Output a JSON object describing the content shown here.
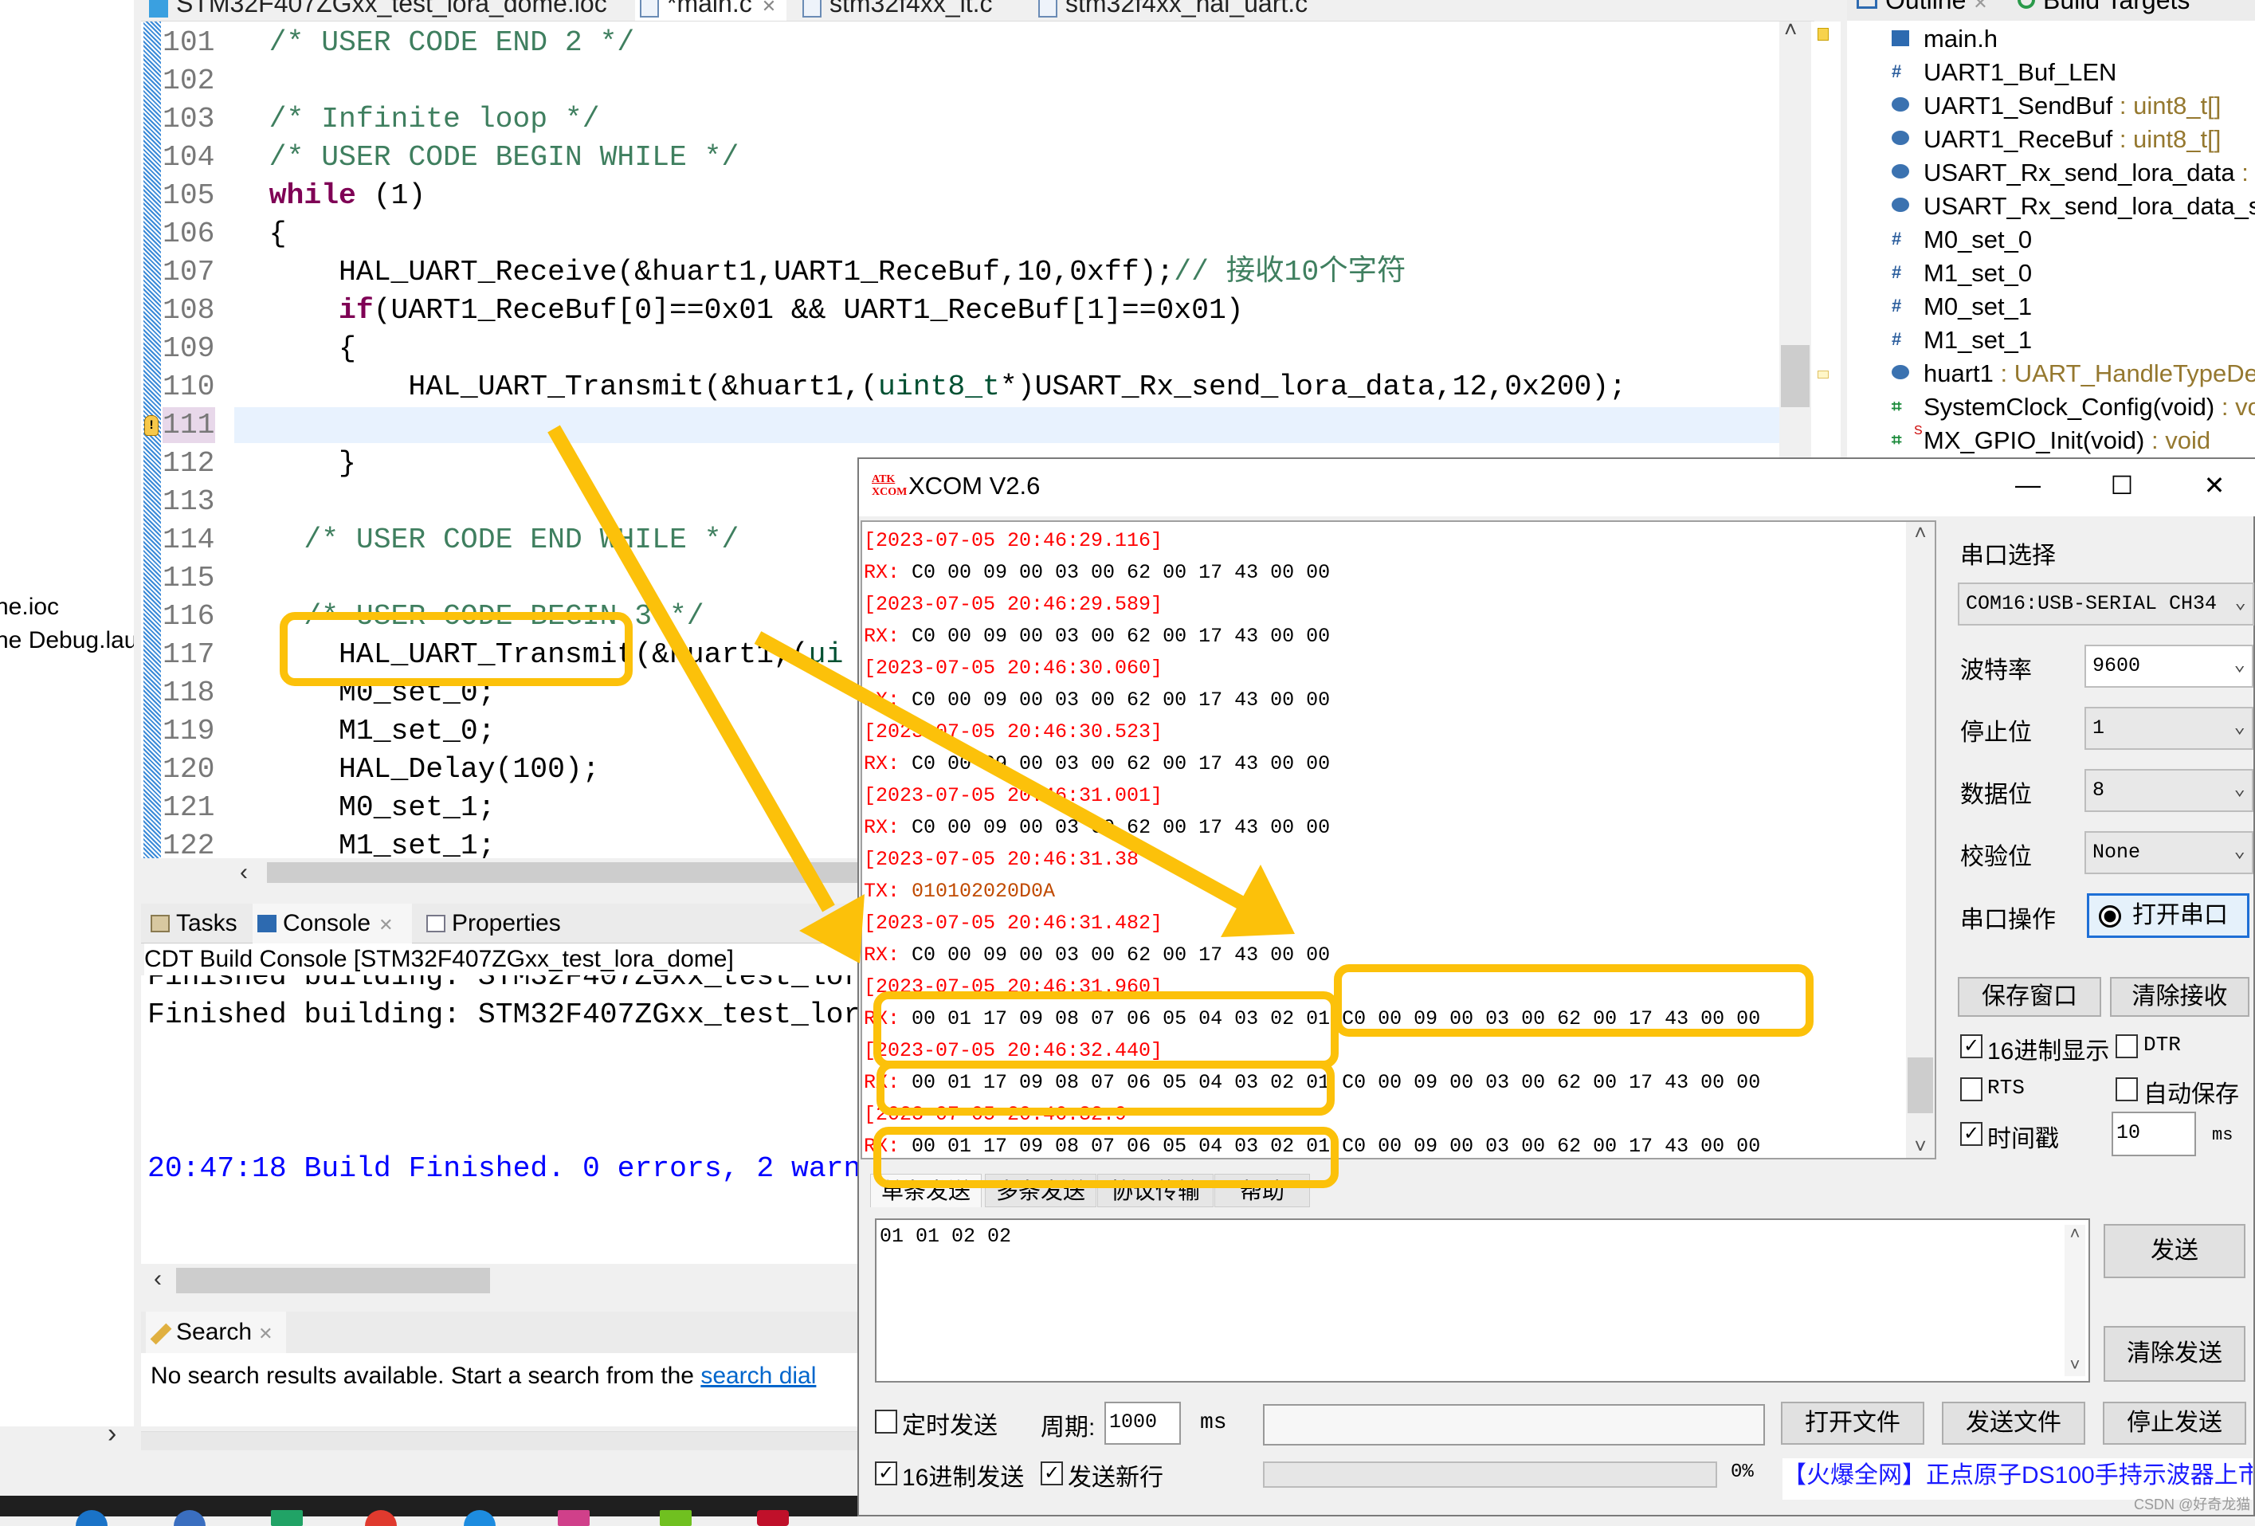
{
  "ide": {
    "left_panel": {
      "items": [
        "ne.ioc",
        "ne Debug.lau"
      ]
    },
    "editor_tabs": [
      {
        "label": "STM32F407ZGxx_test_lora_dome.ioc",
        "active": false
      },
      {
        "label": "*main.c",
        "active": true
      },
      {
        "label": "stm32f4xx_it.c",
        "active": false
      },
      {
        "label": "stm32f4xx_hal_uart.c",
        "active": false
      }
    ],
    "editor": {
      "current_line": "111",
      "warning_line": "111",
      "lines": [
        {
          "n": "101",
          "segs": [
            {
              "t": "  /* USER CODE END 2 */",
              "k": "comment"
            }
          ]
        },
        {
          "n": "102",
          "segs": []
        },
        {
          "n": "103",
          "segs": [
            {
              "t": "  /* Infinite loop */",
              "k": "comment"
            }
          ]
        },
        {
          "n": "104",
          "segs": [
            {
              "t": "  /* USER CODE BEGIN WHILE */",
              "k": "comment"
            }
          ]
        },
        {
          "n": "105",
          "segs": [
            {
              "t": "  ",
              "k": "plain"
            },
            {
              "t": "while",
              "k": "keyword"
            },
            {
              "t": " (1)",
              "k": "plain"
            }
          ]
        },
        {
          "n": "106",
          "segs": [
            {
              "t": "  {",
              "k": "plain"
            }
          ]
        },
        {
          "n": "107",
          "segs": [
            {
              "t": "      HAL_UART_Receive(&huart1,UART1_ReceBuf,10,0xff);",
              "k": "plain"
            },
            {
              "t": "// 接收10个字符",
              "k": "comment"
            }
          ]
        },
        {
          "n": "108",
          "segs": [
            {
              "t": "      ",
              "k": "plain"
            },
            {
              "t": "if",
              "k": "keyword"
            },
            {
              "t": "(UART1_ReceBuf[0]==0x01 && UART1_ReceBuf[1]==0x01)",
              "k": "plain"
            }
          ]
        },
        {
          "n": "109",
          "segs": [
            {
              "t": "      {",
              "k": "plain"
            }
          ]
        },
        {
          "n": "110",
          "segs": [
            {
              "t": "          HAL_UART_Transmit(&huart1,(",
              "k": "plain"
            },
            {
              "t": "uint8_t",
              "k": "type"
            },
            {
              "t": "*)USART_Rx_send_lora_data,12,0x200);",
              "k": "plain"
            }
          ]
        },
        {
          "n": "111",
          "segs": []
        },
        {
          "n": "112",
          "segs": [
            {
              "t": "      }",
              "k": "plain"
            }
          ]
        },
        {
          "n": "113",
          "segs": []
        },
        {
          "n": "114",
          "segs": [
            {
              "t": "    /* USER CODE END WHILE */",
              "k": "comment"
            }
          ]
        },
        {
          "n": "115",
          "segs": []
        },
        {
          "n": "116",
          "segs": [
            {
              "t": "    /* USER CODE BEGIN 3 */",
              "k": "comment"
            }
          ]
        },
        {
          "n": "117",
          "segs": [
            {
              "t": "      HAL_UART_Transmit(&huart1,(",
              "k": "plain"
            },
            {
              "t": "ui",
              "k": "type"
            }
          ]
        },
        {
          "n": "118",
          "segs": [
            {
              "t": "      M0_set_0;",
              "k": "plain"
            }
          ]
        },
        {
          "n": "119",
          "segs": [
            {
              "t": "      M1_set_0;",
              "k": "plain"
            }
          ]
        },
        {
          "n": "120",
          "segs": [
            {
              "t": "      HAL_Delay(100);",
              "k": "plain"
            }
          ]
        },
        {
          "n": "121",
          "segs": [
            {
              "t": "      M0_set_1;",
              "k": "plain"
            }
          ]
        },
        {
          "n": "122",
          "segs": [
            {
              "t": "      M1_set_1;",
              "k": "plain"
            }
          ]
        }
      ]
    },
    "outline": {
      "tabs": [
        "Outline",
        "Build Targets"
      ],
      "items": [
        {
          "icon": "header",
          "name": "main.h",
          "type": ""
        },
        {
          "icon": "macro",
          "name": "UART1_Buf_LEN",
          "type": ""
        },
        {
          "icon": "var",
          "name": "UART1_SendBuf",
          "type": " : uint8_t[]"
        },
        {
          "icon": "var",
          "name": "UART1_ReceBuf",
          "type": " : uint8_t[]"
        },
        {
          "icon": "var",
          "name": "USART_Rx_send_lora_data",
          "type": " : ui"
        },
        {
          "icon": "var",
          "name": "USART_Rx_send_lora_data_set",
          "type": ""
        },
        {
          "icon": "macro",
          "name": "M0_set_0",
          "type": ""
        },
        {
          "icon": "macro",
          "name": "M1_set_0",
          "type": ""
        },
        {
          "icon": "macro",
          "name": "M0_set_1",
          "type": ""
        },
        {
          "icon": "macro",
          "name": "M1_set_1",
          "type": ""
        },
        {
          "icon": "var",
          "name": "huart1",
          "type": " : UART_HandleTypeDe"
        },
        {
          "icon": "func",
          "name": "SystemClock_Config(void)",
          "type": " : vo"
        },
        {
          "icon": "func",
          "name": "MX_GPIO_Init(void)",
          "type": " : void",
          "static": "S"
        }
      ]
    },
    "bottom_tabs": [
      "Tasks",
      "Console",
      "Properties"
    ],
    "console": {
      "title": "CDT Build Console [STM32F407ZGxx_test_lora_dome]",
      "lines": [
        "Finished building: STM32F407ZGxx_test_lor",
        "Finished building: STM32F407ZGxx_test_lor"
      ],
      "result": "20:47:18 Build Finished. 0 errors, 2 warn",
      "result_color": "#0000ff"
    },
    "search": {
      "tab": "Search",
      "message": "No search results available. Start a search from the ",
      "link": "search dial"
    }
  },
  "xcom": {
    "title": "XCOM V2.6",
    "logo": "ATK XCOM",
    "receive_lines": [
      {
        "ts": "[2023-07-05 20:46:29.116]"
      },
      {
        "label": "RX:",
        "data": " C0 00 09 00 03 00 62 00 17 43 00 00"
      },
      {
        "ts": "[2023-07-05 20:46:29.589]"
      },
      {
        "label": "RX:",
        "data": " C0 00 09 00 03 00 62 00 17 43 00 00"
      },
      {
        "ts": "[2023-07-05 20:46:30.060]"
      },
      {
        "label": "RX:",
        "data": " C0 00 09 00 03 00 62 00 17 43 00 00"
      },
      {
        "ts": "[2023-07-05 20:46:30.523]"
      },
      {
        "label": "RX:",
        "data": " C0 00 09 00 03 00 62 00 17 43 00 00"
      },
      {
        "ts": "[2023-07-05 20:46:31.001]"
      },
      {
        "label": "RX:",
        "data": " C0 00 09 00 03 00 62 00 17 43 00 00"
      },
      {
        "ts": "[2023-07-05 20:46:31.38"
      },
      {
        "label": "TX:",
        "data": " 010102020D0A",
        "tx": true
      },
      {
        "ts": "[2023-07-05 20:46:31.482]"
      },
      {
        "label": "RX:",
        "data": " C0 00 09 00 03 00 62 00 17 43 00 00"
      },
      {
        "ts": "[2023-07-05 20:46:31.960]"
      },
      {
        "label": "RX:",
        "data": " 00 01 17 09 08 07 06 05 04 03 02 01 C0 00 09 00 03 00 62 00 17 43 00 00"
      },
      {
        "ts": "[2023-07-05 20:46:32.440]"
      },
      {
        "label": "RX:",
        "data": " 00 01 17 09 08 07 06 05 04 03 02 01 C0 00 09 00 03 00 62 00 17 43 00 00"
      },
      {
        "ts": "[2023-07-05 20:46:32.9"
      },
      {
        "label": "RX:",
        "data": " 00 01 17 09 08 07 06 05 04 03 02 01 C0 00 09 00 03 00 62 00 17 43 00 00"
      }
    ],
    "settings": {
      "port_label": "串口选择",
      "port_value": "COM16:USB-SERIAL CH34",
      "baud_label": "波特率",
      "baud_value": "9600",
      "stop_label": "停止位",
      "stop_value": "1",
      "data_label": "数据位",
      "data_value": "8",
      "parity_label": "校验位",
      "parity_value": "None",
      "op_label": "串口操作",
      "open_button": "打开串口",
      "save_window": "保存窗口",
      "clear_receive": "清除接收",
      "hex_display": {
        "label": "16进制显示",
        "checked": true
      },
      "dtr": {
        "label": "DTR",
        "checked": false
      },
      "rts": {
        "label": "RTS",
        "checked": false
      },
      "auto_save": {
        "label": "自动保存",
        "checked": false
      },
      "timestamp": {
        "label": "时间戳",
        "checked": true,
        "value": "10",
        "unit": "ms"
      }
    },
    "send_tabs": [
      "单条发送",
      "多条发送",
      "协议传输",
      "帮助"
    ],
    "send_text": "01 01 02 02",
    "send_button": "发送",
    "clear_send_button": "清除发送",
    "timed_send": {
      "label": "定时发送",
      "checked": false
    },
    "period_label": "周期:",
    "period_value": "1000",
    "period_unit": "ms",
    "file_path": "",
    "open_file": "打开文件",
    "send_file": "发送文件",
    "stop_send": "停止发送",
    "hex_send": {
      "label": "16进制发送",
      "checked": true
    },
    "send_newline": {
      "label": "发送新行",
      "checked": true
    },
    "progress_percent": 0,
    "progress_text": "0%",
    "ad_text": "【火爆全网】正点原子DS100手持示波器上市",
    "watermark": "CSDN @好奇龙猫"
  },
  "annotation_color": "#fcc10a"
}
